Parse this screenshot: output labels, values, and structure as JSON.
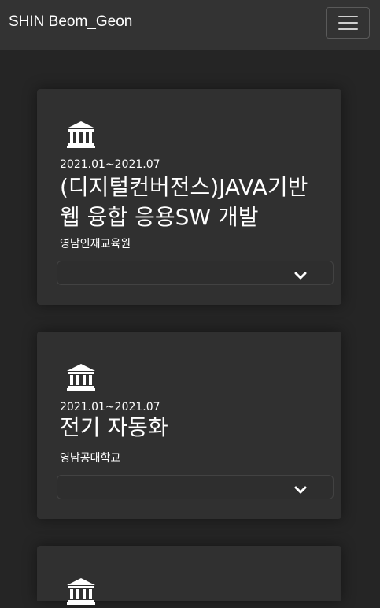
{
  "navbar": {
    "brand": "SHIN Beom_Geon",
    "toggle_icon": "hamburger-menu-icon"
  },
  "education": [
    {
      "icon": "institution-icon",
      "period": "2021.01~2021.07",
      "title": "(디지털컨버전스)JAVA기반 웹 융합 응용SW 개발",
      "org": "영남인재교육원",
      "expand_icon": "chevron-down-icon"
    },
    {
      "icon": "institution-icon",
      "period": "2021.01~2021.07",
      "title": "전기 자동화",
      "org": "영남공대학교",
      "expand_icon": "chevron-down-icon"
    },
    {
      "icon": "institution-icon"
    }
  ],
  "colors": {
    "page_background": "#252525",
    "navbar_background": "#333333",
    "card_background": "#303030",
    "text": "#ffffff"
  }
}
